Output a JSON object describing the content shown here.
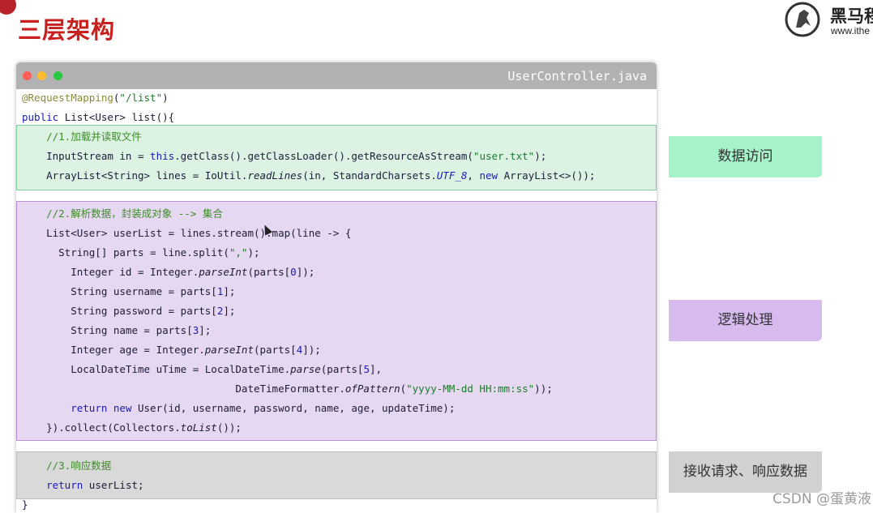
{
  "slide": {
    "title": "三层架构",
    "logo_cn": "黑马程",
    "logo_url": "www.ithe"
  },
  "editor": {
    "filename": "UserController.java",
    "lines": [
      {
        "segments": [
          {
            "t": "@RequestMapping",
            "c": "ann"
          },
          {
            "t": "(",
            "c": ""
          },
          {
            "t": "\"/list\"",
            "c": "str"
          },
          {
            "t": ")",
            "c": ""
          }
        ]
      },
      {
        "segments": [
          {
            "t": "public ",
            "c": "kw"
          },
          {
            "t": "List<User> list(){",
            "c": ""
          }
        ]
      },
      {
        "segments": [
          {
            "t": "    //1.加载并读取文件",
            "c": "cm"
          }
        ]
      },
      {
        "segments": [
          {
            "t": "    InputStream in = ",
            "c": ""
          },
          {
            "t": "this",
            "c": "kw"
          },
          {
            "t": ".getClass().getClassLoader().getResourceAsStream(",
            "c": ""
          },
          {
            "t": "\"user.txt\"",
            "c": "str"
          },
          {
            "t": ");",
            "c": ""
          }
        ]
      },
      {
        "segments": [
          {
            "t": "    ArrayList<String> lines = IoUtil.",
            "c": ""
          },
          {
            "t": "readLines",
            "c": "it"
          },
          {
            "t": "(in, StandardCharsets.",
            "c": ""
          },
          {
            "t": "UTF_8",
            "c": "it kw"
          },
          {
            "t": ", ",
            "c": ""
          },
          {
            "t": "new",
            "c": "kw"
          },
          {
            "t": " ArrayList<>());",
            "c": ""
          }
        ]
      },
      {
        "segments": [
          {
            "t": "    //2.解析数据，封装成对象 --> 集合",
            "c": "cm"
          }
        ]
      },
      {
        "segments": [
          {
            "t": "    List<User> userList = lines.stream().map(line -> {",
            "c": ""
          }
        ]
      },
      {
        "segments": [
          {
            "t": "      String[] parts = line.split(",
            "c": ""
          },
          {
            "t": "\",\"",
            "c": "str"
          },
          {
            "t": ");",
            "c": ""
          }
        ]
      },
      {
        "segments": [
          {
            "t": "        Integer id = Integer.",
            "c": ""
          },
          {
            "t": "parseInt",
            "c": "it"
          },
          {
            "t": "(parts[",
            "c": ""
          },
          {
            "t": "0",
            "c": "num"
          },
          {
            "t": "]);",
            "c": ""
          }
        ]
      },
      {
        "segments": [
          {
            "t": "        String username = parts[",
            "c": ""
          },
          {
            "t": "1",
            "c": "num"
          },
          {
            "t": "];",
            "c": ""
          }
        ]
      },
      {
        "segments": [
          {
            "t": "        String password = parts[",
            "c": ""
          },
          {
            "t": "2",
            "c": "num"
          },
          {
            "t": "];",
            "c": ""
          }
        ]
      },
      {
        "segments": [
          {
            "t": "        String name = parts[",
            "c": ""
          },
          {
            "t": "3",
            "c": "num"
          },
          {
            "t": "];",
            "c": ""
          }
        ]
      },
      {
        "segments": [
          {
            "t": "        Integer age = Integer.",
            "c": ""
          },
          {
            "t": "parseInt",
            "c": "it"
          },
          {
            "t": "(parts[",
            "c": ""
          },
          {
            "t": "4",
            "c": "num"
          },
          {
            "t": "]);",
            "c": ""
          }
        ]
      },
      {
        "segments": [
          {
            "t": "        LocalDateTime uTime = LocalDateTime.",
            "c": ""
          },
          {
            "t": "parse",
            "c": "it"
          },
          {
            "t": "(parts[",
            "c": ""
          },
          {
            "t": "5",
            "c": "num"
          },
          {
            "t": "],",
            "c": ""
          }
        ]
      },
      {
        "segments": [
          {
            "t": "                                   DateTimeFormatter.",
            "c": ""
          },
          {
            "t": "ofPattern",
            "c": "it"
          },
          {
            "t": "(",
            "c": ""
          },
          {
            "t": "\"yyyy-MM-dd HH:mm:ss\"",
            "c": "str"
          },
          {
            "t": "));",
            "c": ""
          }
        ]
      },
      {
        "segments": [
          {
            "t": "        ",
            "c": ""
          },
          {
            "t": "return new",
            "c": "kw"
          },
          {
            "t": " User(id, username, password, name, age, updateTime);",
            "c": ""
          }
        ]
      },
      {
        "segments": [
          {
            "t": "    }).collect(Collectors.",
            "c": ""
          },
          {
            "t": "toList",
            "c": "it"
          },
          {
            "t": "());",
            "c": ""
          }
        ]
      },
      {
        "segments": [
          {
            "t": "    //3.响应数据",
            "c": "cm"
          }
        ]
      },
      {
        "segments": [
          {
            "t": "    ",
            "c": ""
          },
          {
            "t": "return",
            "c": "kw"
          },
          {
            "t": " userList;",
            "c": ""
          }
        ]
      },
      {
        "segments": [
          {
            "t": "}",
            "c": ""
          }
        ]
      }
    ]
  },
  "layers": {
    "data_access": "数据访问",
    "logic": "逻辑处理",
    "request": "接收请求、响应数据"
  },
  "watermark": "CSDN @蛋黄液",
  "colors": {
    "title_red": "#c8201f",
    "green_block": "#dcf3e3",
    "purple_block": "#e6d8f0",
    "gray_block": "#d9d9d9",
    "green_label": "#a6f2c9",
    "purple_label": "#d7bbef",
    "gray_label": "#d1d1d1"
  }
}
